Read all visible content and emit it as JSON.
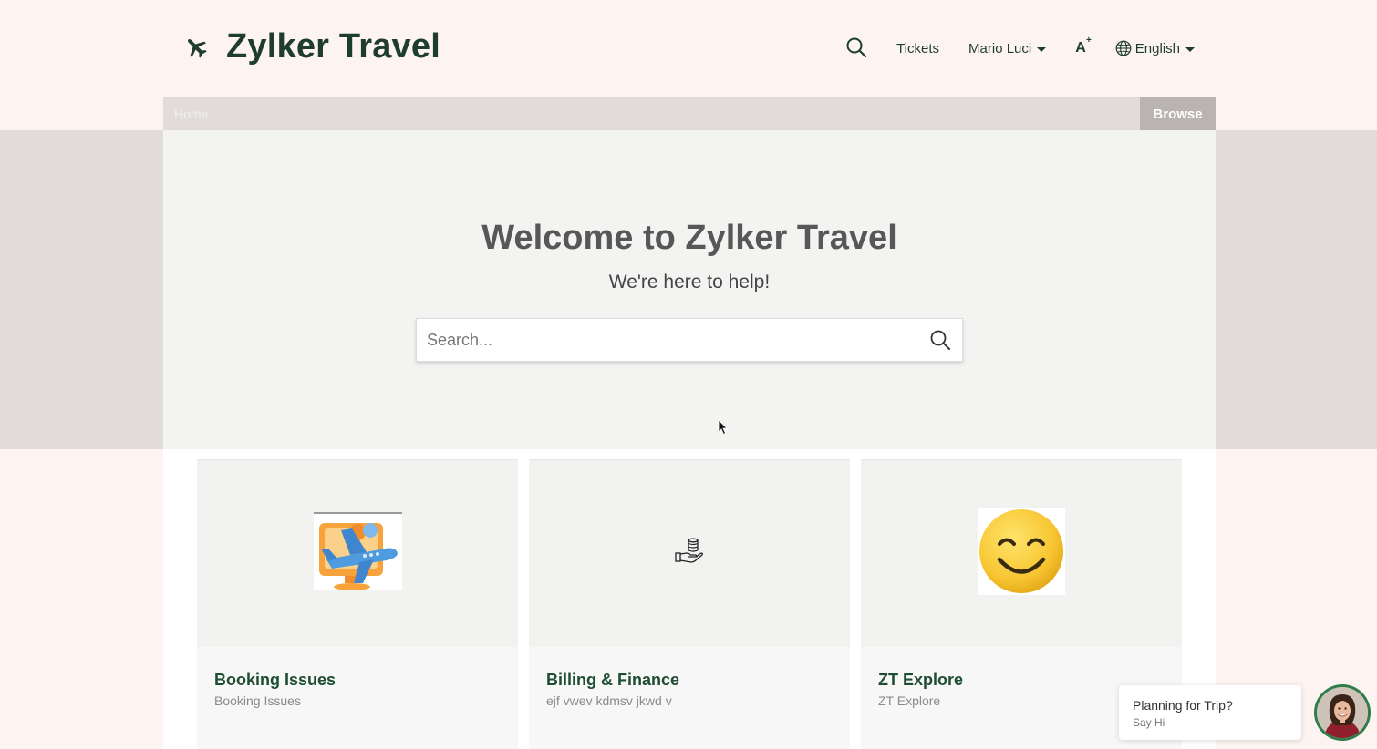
{
  "brand": {
    "name": "Zylker Travel"
  },
  "nav": {
    "tickets": "Tickets",
    "user": "Mario Luci",
    "font_toggle": "A",
    "font_toggle_sup": "+",
    "language": "English"
  },
  "breadcrumb": {
    "home": "Home",
    "browse": "Browse"
  },
  "hero": {
    "title": "Welcome to Zylker Travel",
    "subtitle": "We're here to help!",
    "search_placeholder": "Search..."
  },
  "cards": [
    {
      "title": "Booking Issues",
      "description": "Booking Issues",
      "icon": "airplane-monitor-icon"
    },
    {
      "title": "Billing & Finance",
      "description": "ejf vwev kdmsv jkwd v",
      "icon": "coins-hand-icon"
    },
    {
      "title": "ZT Explore",
      "description": "ZT Explore",
      "icon": "smiley-icon"
    }
  ],
  "chat": {
    "title": "Planning for Trip?",
    "subtitle": "Say Hi"
  },
  "colors": {
    "brand_green": "#1f3d2e",
    "card_title": "#1f4d34",
    "band": "#e1dcd9",
    "page_bg": "#fdf3f1"
  }
}
